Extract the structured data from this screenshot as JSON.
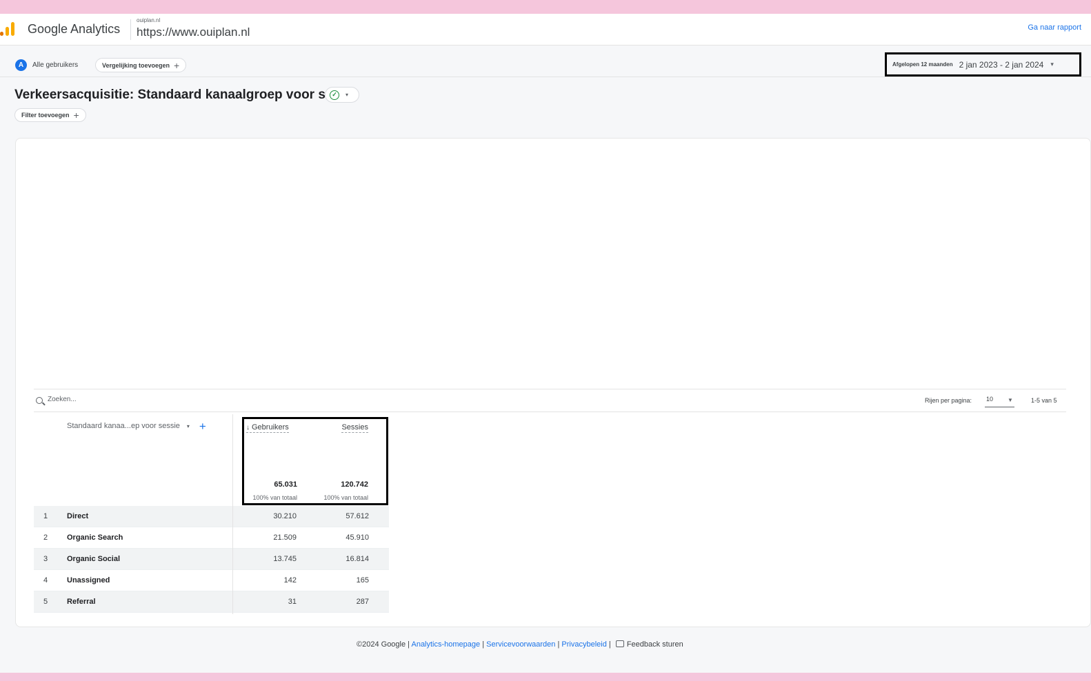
{
  "header": {
    "app_name": "Google Analytics",
    "account_small": "ouiplan.nl",
    "account_url": "https://www.ouiplan.nl",
    "goto_report": "Ga naar rapport"
  },
  "toolbar": {
    "avatar_letter": "A",
    "segment_label": "Alle gebruikers",
    "compare_label": "Vergelijking toevoegen",
    "compare_plus": "+",
    "date_label": "Afgelopen 12 maanden",
    "date_range": "2 jan 2023 - 2 jan 2024",
    "date_caret": "▾"
  },
  "report": {
    "title": "Verkeersacquisitie: Standaard kanaalgroep voor sessie",
    "status_icon": "check-circle-icon",
    "filter_label": "Filter toevoegen",
    "filter_plus": "+"
  },
  "table": {
    "search_placeholder": "Zoeken...",
    "rows_per_page_label": "Rijen per pagina:",
    "rows_per_page_value": "10",
    "pager_info": "1-5 van 5",
    "dimension_header": "Standaard kanaa...ep voor sessie",
    "add_dimension": "+",
    "metrics": [
      {
        "label": "Gebruikers",
        "sort": "↓",
        "total": "65.031",
        "total_pct": "100% van totaal"
      },
      {
        "label": "Sessies",
        "total": "120.742",
        "total_pct": "100% van totaal"
      }
    ],
    "rows": [
      {
        "index": "1",
        "channel": "Direct",
        "users": "30.210",
        "sessions": "57.612"
      },
      {
        "index": "2",
        "channel": "Organic Search",
        "users": "21.509",
        "sessions": "45.910"
      },
      {
        "index": "3",
        "channel": "Organic Social",
        "users": "13.745",
        "sessions": "16.814"
      },
      {
        "index": "4",
        "channel": "Unassigned",
        "users": "142",
        "sessions": "165"
      },
      {
        "index": "5",
        "channel": "Referral",
        "users": "31",
        "sessions": "287"
      }
    ]
  },
  "footer": {
    "copyright": "©2024 Google |",
    "link_home": "Analytics-homepage",
    "sep1": "|",
    "link_terms": "Servicevoorwaarden",
    "sep2": "|",
    "link_privacy": "Privacybeleid",
    "sep3": "|",
    "feedback": "Feedback sturen"
  },
  "colors": {
    "accent": "#1a73e8",
    "frame_border": "#f5c6dc",
    "logo_orange": "#f9ab00",
    "logo_dark_orange": "#e37400",
    "success": "#1e8e3e"
  }
}
